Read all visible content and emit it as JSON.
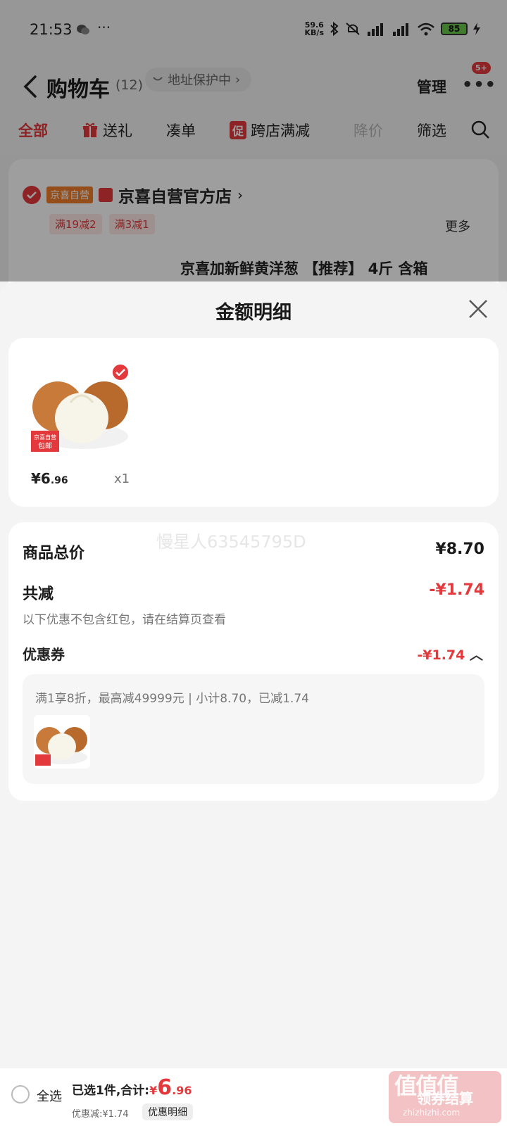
{
  "status_bar": {
    "time": "21:53",
    "dots": "···",
    "net_speed_value": "59.6",
    "net_speed_unit": "KB/s",
    "battery": "85"
  },
  "header": {
    "title": "购物车",
    "count": "(12)",
    "address": "地址保护中",
    "manage": "管理",
    "badge": "5+"
  },
  "tabs": [
    {
      "label": "全部"
    },
    {
      "label": "送礼"
    },
    {
      "label": "凑单"
    },
    {
      "label": "跨店满减",
      "tag": "促"
    },
    {
      "label": "降价"
    },
    {
      "label": "筛选"
    }
  ],
  "shop": {
    "tag": "京喜自营",
    "name": "京喜自营官方店",
    "promos": [
      "满19减2",
      "满3减1"
    ],
    "more": "更多",
    "product_title": "京喜加新鲜黄洋葱 【推荐】 4斤 含箱"
  },
  "sheet": {
    "title": "金额明细",
    "item": {
      "badge_top": "京喜自营",
      "badge_bottom": "包邮",
      "price_yen": "¥",
      "price_int": "6",
      "price_dec": ".96",
      "qty": "x1"
    },
    "watermark": "慢星人63545795D",
    "total_label": "商品总价",
    "total_value": "¥8.70",
    "reduce_label": "共减",
    "reduce_value": "-¥1.74",
    "note": "以下优惠不包含红包，请在结算页查看",
    "coupon_label": "优惠券",
    "coupon_value": "-¥1.74",
    "coupon_desc": "满1享8折，最高减49999元 | 小计8.70，已减1.74"
  },
  "bottom": {
    "select_all": "全选",
    "summary_prefix": "已选1件,合计:",
    "price_yen": "¥",
    "price_int": "6",
    "price_dec": ".96",
    "discount": "优惠减:¥1.74",
    "detail_chip": "优惠明细",
    "checkout": "领券结算",
    "site_mark": "值值值",
    "site_url": "zhizhizhi.com"
  },
  "colors": {
    "accent": "#e4393c",
    "orange_tag": "#f07f2a",
    "battery": "#69c74a"
  }
}
